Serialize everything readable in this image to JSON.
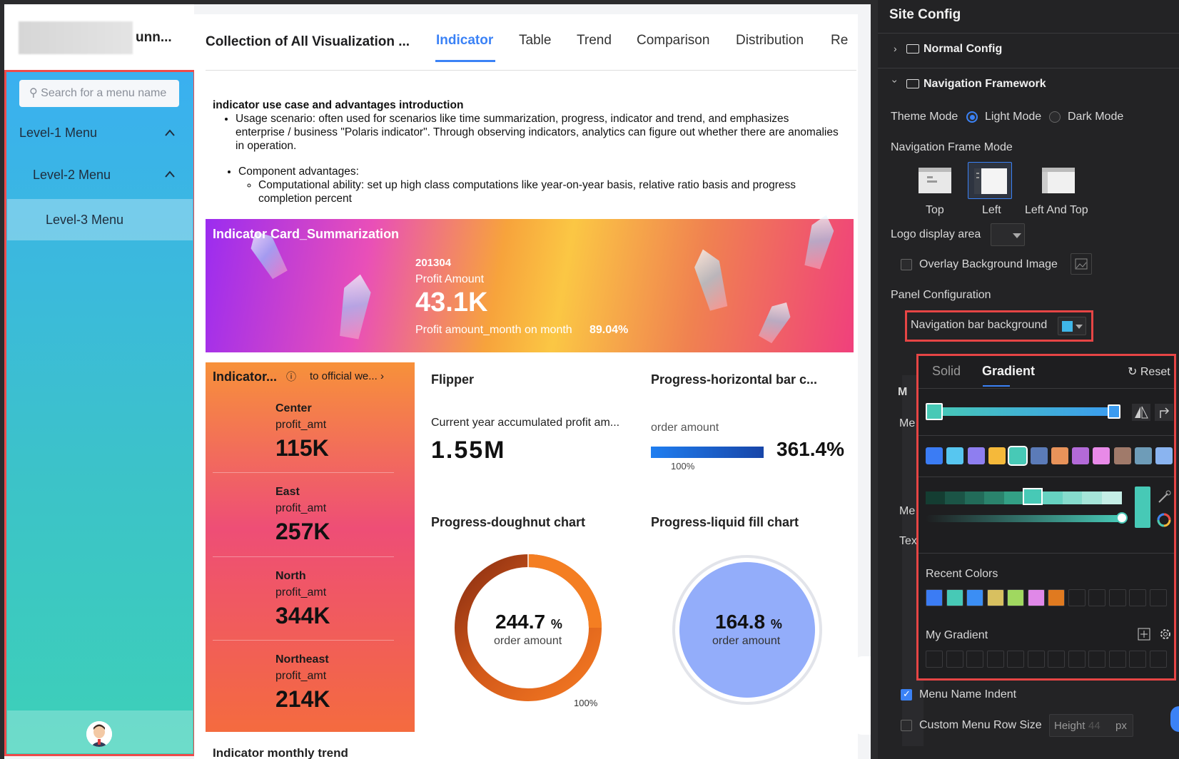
{
  "app": {
    "logo_text": "unn...",
    "search_placeholder": "Search for a menu name",
    "menu": {
      "level1": "Level-1 Menu",
      "level2": "Level-2 Menu",
      "level3": "Level-3 Menu"
    }
  },
  "main": {
    "title": "Collection of All Visualization ...",
    "tabs": [
      "Indicator",
      "Table",
      "Trend",
      "Comparison",
      "Distribution",
      "Re"
    ],
    "active_tab": "Indicator",
    "intro": {
      "heading": "indicator use case and advantages introduction",
      "bullet1": "Usage scenario: often used for scenarios like time summarization, progress, indicator and trend, and emphasizes enterprise / business \"Polaris indicator\". Through observing indicators, analytics can figure out whether there are anomalies in operation.",
      "bullet2": "Component advantages:",
      "sub_bullet": "Computational ability: set up high class computations like year-on-year basis, relative ratio basis and progress completion percent"
    },
    "banner": {
      "title": "Indicator Card_Summarization",
      "date": "201304",
      "label": "Profit Amount",
      "value": "43.1K",
      "mom_label": "Profit amount_month on month",
      "mom_value": "89.04%"
    },
    "regional": {
      "title": "Indicator...",
      "link": "to official we...",
      "items": [
        {
          "name": "Center",
          "metric": "profit_amt",
          "value": "115K"
        },
        {
          "name": "East",
          "metric": "profit_amt",
          "value": "257K"
        },
        {
          "name": "North",
          "metric": "profit_amt",
          "value": "344K"
        },
        {
          "name": "Northeast",
          "metric": "profit_amt",
          "value": "214K"
        }
      ]
    },
    "flipper": {
      "title": "Flipper",
      "label": "Current year accumulated profit am...",
      "value": "1.55M"
    },
    "progress_bar": {
      "title": "Progress-horizontal bar c...",
      "label": "order amount",
      "value": "361.4%",
      "tick": "100%",
      "fraction": 1.0
    },
    "doughnut": {
      "title": "Progress-doughnut chart",
      "value": "244.7",
      "unit": "%",
      "label": "order amount",
      "tick": "100%",
      "percent": 244.7
    },
    "liquid": {
      "title": "Progress-liquid fill chart",
      "value": "164.8",
      "unit": "%",
      "label": "order amount"
    },
    "trend_title": "Indicator monthly trend"
  },
  "panel": {
    "title": "Site Config",
    "normal_config": "Normal Config",
    "nav_framework": "Navigation Framework",
    "theme_mode_label": "Theme Mode",
    "light_mode": "Light Mode",
    "dark_mode": "Dark Mode",
    "nav_frame_mode_label": "Navigation Frame Mode",
    "frame_modes": [
      "Top",
      "Left",
      "Left And Top"
    ],
    "selected_frame": "Left",
    "logo_display_area": "Logo display area",
    "overlay_bg": "Overlay Background Image",
    "panel_config": "Panel Configuration",
    "nav_bar_bg": "Navigation bar background",
    "nav_bar_color": "#3fb6e8",
    "partial_behind": [
      "M",
      "Me",
      "Me",
      "Tex"
    ],
    "menu_name_indent": "Menu Name Indent",
    "custom_menu_row": "Custom Menu Row Size",
    "height_label": "Height",
    "height_value": "44",
    "height_unit": "px"
  },
  "popup": {
    "tab_solid": "Solid",
    "tab_gradient": "Gradient",
    "reset": "Reset",
    "gradient_start": "#47c9b6",
    "gradient_end": "#3b9bf0",
    "swatches": [
      "#3b7cf4",
      "#57c6f0",
      "#8e7ef0",
      "#f5b93a",
      "#47c9b6",
      "#5b7bb8",
      "#e8935a",
      "#b36ad8",
      "#e88ae8",
      "#a07a6a",
      "#6e9cb8",
      "#8ab4f0"
    ],
    "shades": [
      "#143d32",
      "#1b5446",
      "#226b59",
      "#2a836c",
      "#33a085",
      "#47c9b6",
      "#66d2c1",
      "#86dccd",
      "#a6e5d9",
      "#c5eee6"
    ],
    "recent_label": "Recent Colors",
    "recent_colors": [
      "#3b7cf4",
      "#47c9b6",
      "#3b8ef4",
      "#d8c060",
      "#a0d860",
      "#e088e8",
      "#e07a20"
    ],
    "my_gradient_label": "My Gradient"
  }
}
